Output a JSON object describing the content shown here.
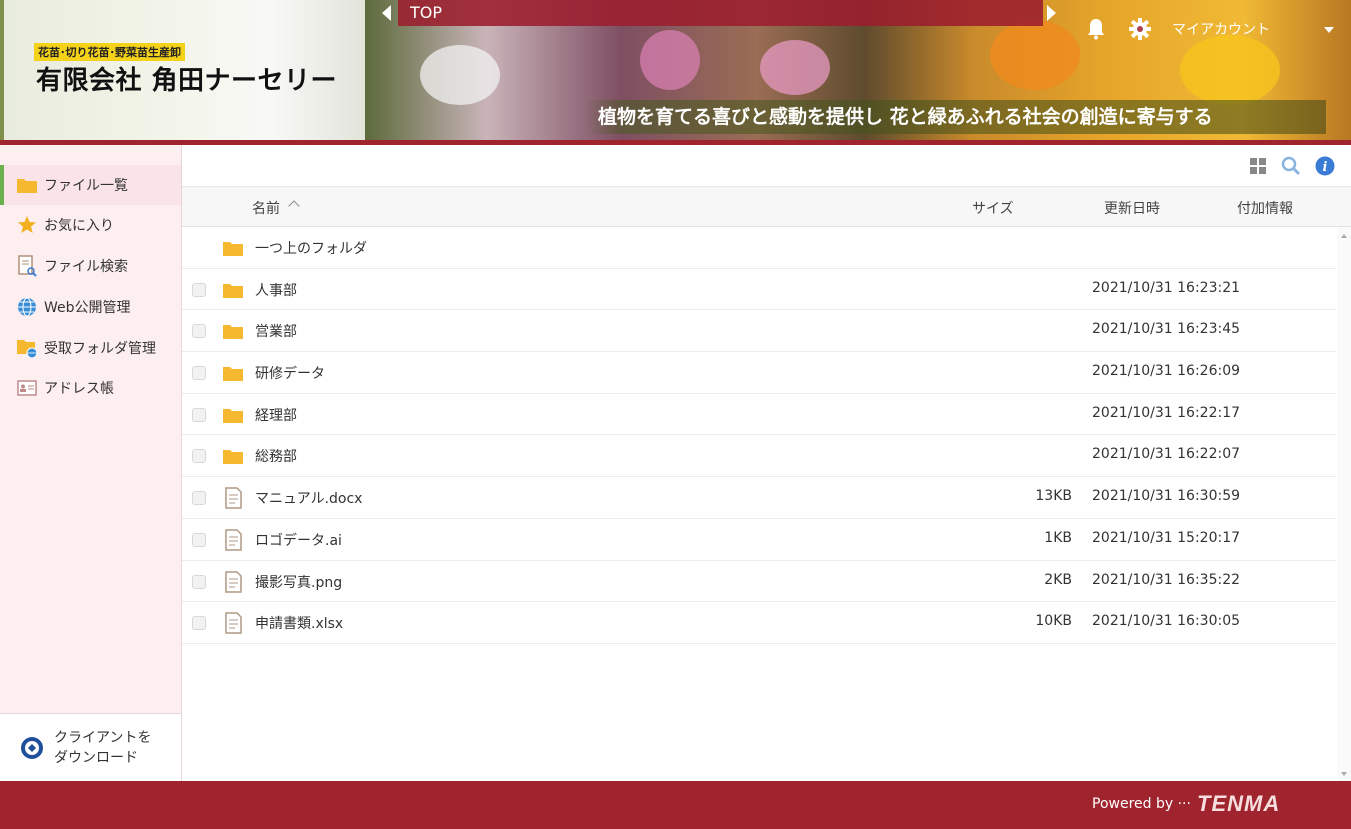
{
  "header": {
    "tagline_small": "花苗･切り花苗･野菜苗生産卸",
    "company_name": "有限会社 角田ナーセリー",
    "slogan": "植物を育てる喜びと感動を提供し 花と緑あふれる社会の創造に寄与する",
    "topbar_label": "TOP",
    "account_label": "マイアカウント",
    "accent_color": "#a0242e"
  },
  "sidebar": {
    "items": [
      {
        "label": "ファイル一覧",
        "icon": "folder-icon",
        "active": true
      },
      {
        "label": "お気に入り",
        "icon": "star-icon",
        "active": false
      },
      {
        "label": "ファイル検索",
        "icon": "file-search-icon",
        "active": false
      },
      {
        "label": "Web公開管理",
        "icon": "globe-icon",
        "active": false
      },
      {
        "label": "受取フォルダ管理",
        "icon": "folder-globe-icon",
        "active": false
      },
      {
        "label": "アドレス帳",
        "icon": "address-card-icon",
        "active": false
      }
    ],
    "client_line1": "クライアントを",
    "client_line2": "ダウンロード"
  },
  "table": {
    "columns": {
      "name": "名前",
      "size": "サイズ",
      "date": "更新日時",
      "extra": "付加情報"
    },
    "parent_folder": "一つ上のフォルダ",
    "rows": [
      {
        "name": "人事部",
        "type": "folder",
        "size": "",
        "date": "2021/10/31 16:23:21"
      },
      {
        "name": "営業部",
        "type": "folder",
        "size": "",
        "date": "2021/10/31 16:23:45"
      },
      {
        "name": "研修データ",
        "type": "folder",
        "size": "",
        "date": "2021/10/31 16:26:09"
      },
      {
        "name": "経理部",
        "type": "folder",
        "size": "",
        "date": "2021/10/31 16:22:17"
      },
      {
        "name": "総務部",
        "type": "folder",
        "size": "",
        "date": "2021/10/31 16:22:07"
      },
      {
        "name": "マニュアル.docx",
        "type": "file",
        "size": "13KB",
        "date": "2021/10/31 16:30:59"
      },
      {
        "name": "ロゴデータ.ai",
        "type": "file",
        "size": "1KB",
        "date": "2021/10/31 15:20:17"
      },
      {
        "name": "撮影写真.png",
        "type": "file",
        "size": "2KB",
        "date": "2021/10/31 16:35:22"
      },
      {
        "name": "申請書類.xlsx",
        "type": "file",
        "size": "10KB",
        "date": "2021/10/31 16:30:05"
      }
    ]
  },
  "footer": {
    "powered_by": "Powered by ···",
    "brand": "TENMA"
  }
}
